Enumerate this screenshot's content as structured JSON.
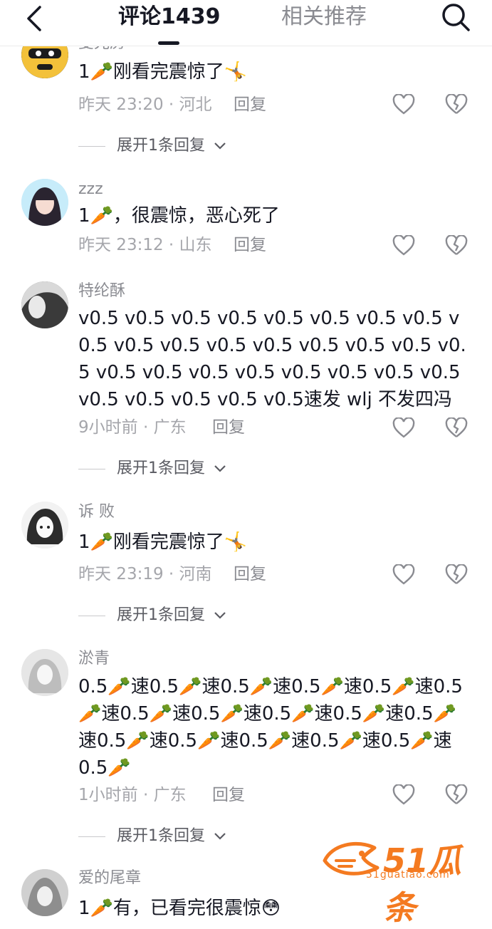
{
  "header": {
    "tab_comments": "评论1439",
    "tab_related": "相关推荐"
  },
  "comments": [
    {
      "username": "菱光房",
      "content": "1🥕刚看完震惊了🤸",
      "time": "昨天 23:20 · 河北",
      "reply_label": "回复",
      "expand_label": "展开1条回复"
    },
    {
      "username": "zzz",
      "content": "1🥕，很震惊，恶心死了",
      "time": "昨天 23:12 · 山东",
      "reply_label": "回复"
    },
    {
      "username": "特纶酥",
      "content": "v0.5 v0.5 v0.5 v0.5 v0.5 v0.5 v0.5 v0.5 v0.5 v0.5 v0.5 v0.5 v0.5 v0.5 v0.5 v0.5 v0.5 v0.5 v0.5 v0.5 v0.5 v0.5 v0.5 v0.5 v0.5 v0.5 v0.5 v0.5 v0.5 v0.5速发 wlj 不发四冯",
      "time": "9小时前 · 广东",
      "reply_label": "回复",
      "expand_label": "展开1条回复"
    },
    {
      "username": "诉 败",
      "content": "1🥕刚看完震惊了🤸",
      "time": "昨天 23:19 · 河南",
      "reply_label": "回复",
      "expand_label": "展开1条回复"
    },
    {
      "username": "淤青",
      "content": "0.5🥕速0.5🥕速0.5🥕速0.5🥕速0.5🥕速0.5🥕速0.5🥕速0.5🥕速0.5🥕速0.5🥕速0.5🥕速0.5🥕速0.5🥕速0.5🥕速0.5🥕速0.5🥕速0.5🥕",
      "time": "1小时前 · 广东",
      "reply_label": "回复",
      "expand_label": "展开1条回复"
    },
    {
      "username": "爱的尾章",
      "content": "1🥕有，已看完很震惊😳"
    }
  ],
  "watermark": {
    "brand": "51瓜条",
    "url": "51guatiao.com"
  },
  "icons": {
    "back": "chevron-left-icon",
    "search": "search-icon",
    "like": "heart-icon",
    "dislike": "broken-heart-icon",
    "expand": "chevron-down-icon"
  }
}
